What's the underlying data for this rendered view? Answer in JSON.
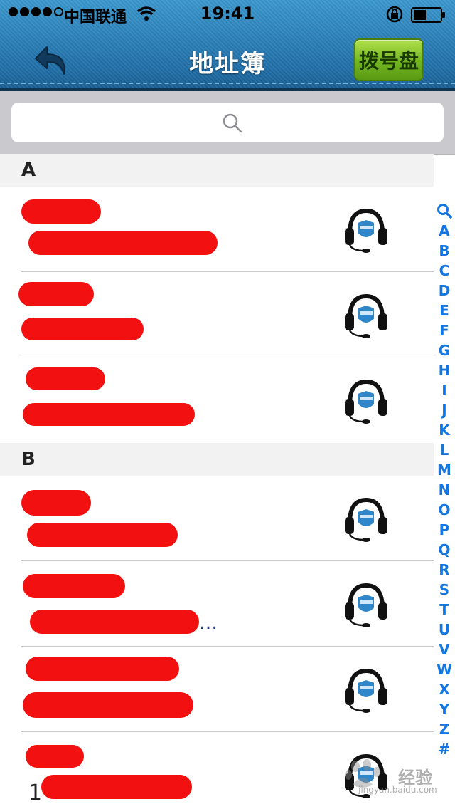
{
  "status_bar": {
    "carrier": "中国联通",
    "time": "19:41"
  },
  "nav": {
    "title": "地址簿",
    "dialpad_label": "拨号盘"
  },
  "search": {
    "placeholder": ""
  },
  "sections": [
    {
      "letter": "A"
    },
    {
      "letter": "B"
    }
  ],
  "visible_fragments": {
    "row_b2_detail": "…",
    "row_b4_number_prefix": "1"
  },
  "alpha_index": [
    "Q",
    "A",
    "B",
    "C",
    "D",
    "E",
    "F",
    "G",
    "H",
    "I",
    "J",
    "K",
    "L",
    "M",
    "N",
    "O",
    "P",
    "Q",
    "R",
    "S",
    "T",
    "U",
    "V",
    "W",
    "X",
    "Y",
    "Z",
    "#"
  ],
  "watermark": {
    "name": "经验",
    "site": "jingyan.baidu.com"
  },
  "colors": {
    "header_blue": "#2a86c1",
    "dialpad_green": "#72b520",
    "index_blue": "#1476e0",
    "redaction_red": "#f21010"
  },
  "icons": {
    "back": "back-arrow-icon",
    "search": "search-icon",
    "call": "headset-icon"
  }
}
